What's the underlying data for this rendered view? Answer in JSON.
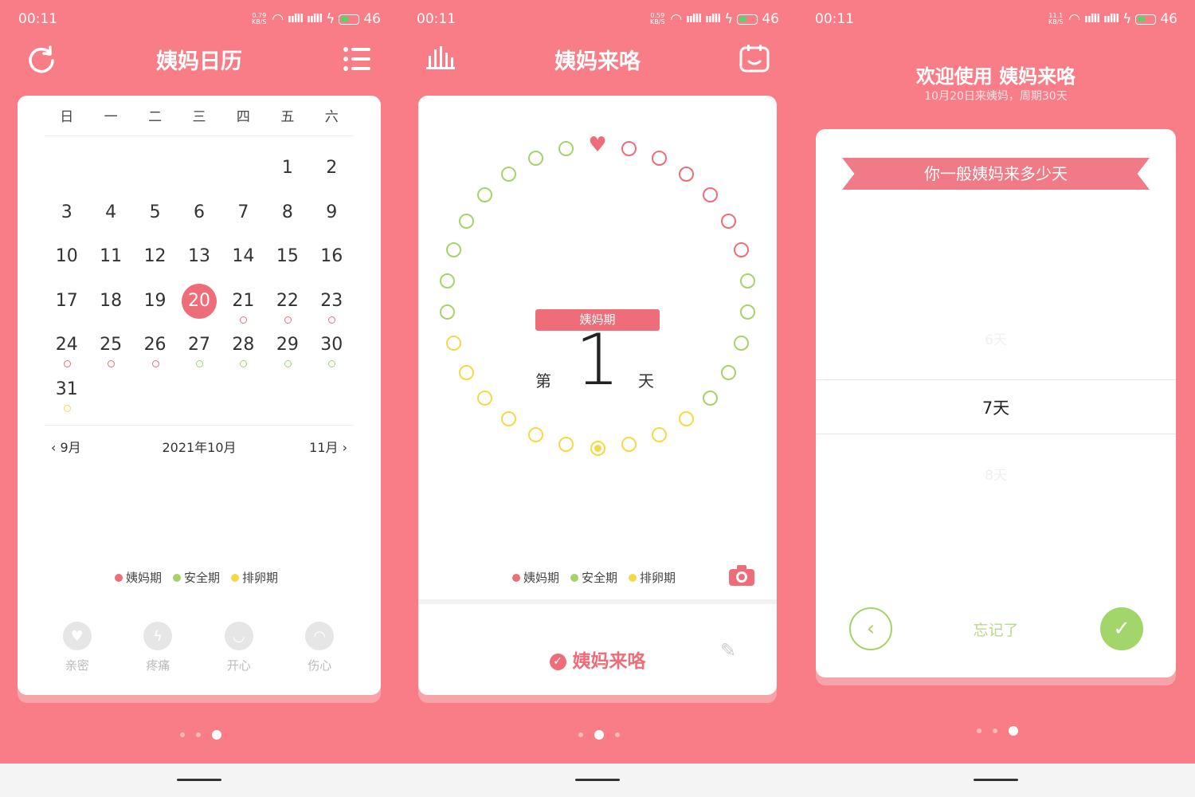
{
  "status": [
    {
      "time": "00:11",
      "kbs": "0.79 KB/S",
      "battery": "46"
    },
    {
      "time": "00:11",
      "kbs": "0.59 KB/S",
      "battery": "46"
    },
    {
      "time": "00:11",
      "kbs": "11.1 KB/S",
      "battery": "46"
    }
  ],
  "s1": {
    "title": "姨妈日历",
    "weekdays": [
      "日",
      "一",
      "二",
      "三",
      "四",
      "五",
      "六"
    ],
    "prev_month": "‹ 9月",
    "current_month": "2021年10月",
    "next_month": "11月 ›",
    "selected_day": "20",
    "moods": [
      "亲密",
      "疼痛",
      "开心",
      "伤心"
    ]
  },
  "legend": {
    "period": "姨妈期",
    "safe": "安全期",
    "ovulation": "排卵期"
  },
  "colors": {
    "period": "#ee6d79",
    "safe": "#a9d16a",
    "ovulation": "#f5d84a",
    "background": "#f97d87",
    "confirm": "#a2d66a"
  },
  "s2": {
    "title": "姨妈来咯",
    "day_prefix": "第",
    "day_number": "1",
    "day_suffix": "天",
    "phase": "姨妈期",
    "arrival_button": "姨妈来咯"
  },
  "s3": {
    "title": "欢迎使用 姨妈来咯",
    "subtitle": "10月20日来姨妈，周期30天",
    "question": "你一般姨妈来多少天",
    "options": [
      "6天",
      "7天",
      "8天"
    ],
    "forgot": "忘记了"
  },
  "icons": [
    "refresh-icon",
    "list-icon",
    "chart-icon",
    "calendar-face-icon",
    "camera-icon",
    "edit-icon",
    "heart-icon",
    "back-icon",
    "check-icon"
  ]
}
